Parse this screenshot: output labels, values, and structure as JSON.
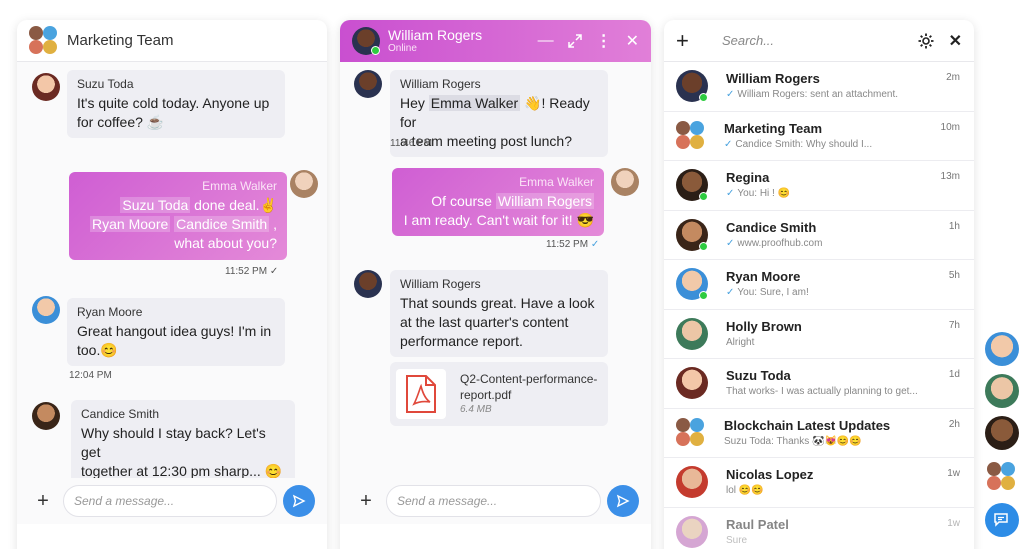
{
  "panel1": {
    "title": "Marketing Team",
    "messages": [
      {
        "name": "Suzu Toda",
        "line1": "It's quite cold today. Anyone up",
        "line2": "for coffee? ☕"
      },
      {
        "name": "Emma Walker",
        "m1": "Suzu Toda",
        "t1": " done deal.✌",
        "m2": "Ryan Moore",
        "m3": "Candice Smith",
        "t2": " ,",
        "t3": "what about you?",
        "time": "11:52 PM"
      },
      {
        "name": "Ryan Moore",
        "line1": "Great hangout idea guys! I'm in",
        "line2": "too.😊",
        "time": "12:04 PM"
      },
      {
        "name": "Candice Smith",
        "line1": "Why should I stay back? Let's get",
        "line2": "together at 12:30 pm sharp... 😊"
      }
    ],
    "placeholder": "Send a message..."
  },
  "panel2": {
    "title": "William Rogers",
    "status": "Online",
    "messages": [
      {
        "name": "William Rogers",
        "pre": "Hey ",
        "mention": "Emma Walker",
        "post": " 👋! Ready for",
        "line2": "a team meeting post lunch?",
        "time": "11:46 PM"
      },
      {
        "name": "Emma Walker",
        "pre": "Of course ",
        "mention": "William Rogers",
        "line2": "I am ready. Can't wait for it! 😎",
        "time": "11:52 PM"
      },
      {
        "name": "William Rogers",
        "line1": "That sounds great. Have a look",
        "line2": "at the last quarter's content",
        "line3": "performance report."
      }
    ],
    "file": {
      "name_line1": "Q2-Content-performance-",
      "name_line2": "report.pdf",
      "size": "6.4 MB"
    },
    "placeholder": "Send a message..."
  },
  "panel3": {
    "search_placeholder": "Search...",
    "items": [
      {
        "name": "William Rogers",
        "sub": "William Rogers: sent an attachment.",
        "time": "2m",
        "check": true
      },
      {
        "name": "Marketing Team",
        "sub": "Candice Smith: Why should I...",
        "time": "10m",
        "check": true
      },
      {
        "name": "Regina",
        "sub": "You: Hi ! 😊",
        "time": "13m",
        "check": true
      },
      {
        "name": "Candice Smith",
        "sub": "www.proofhub.com",
        "time": "1h",
        "check": true
      },
      {
        "name": "Ryan Moore",
        "sub": "You: Sure, I am!",
        "time": "5h",
        "check": true
      },
      {
        "name": "Holly Brown",
        "sub": "Alright",
        "time": "7h",
        "check": false
      },
      {
        "name": "Suzu Toda",
        "sub": "That works- I was actually planning to get...",
        "time": "1d",
        "check": false
      },
      {
        "name": "Blockchain Latest Updates",
        "sub": "Suzu Toda: Thanks 🐼😻😊😊",
        "time": "2h",
        "check": false
      },
      {
        "name": "Nicolas Lopez",
        "sub": "lol 😊😊",
        "time": "1w",
        "check": false
      },
      {
        "name": "Raul Patel",
        "sub": "Sure",
        "time": "1w",
        "check": false
      }
    ]
  },
  "colors": {
    "accent": "#cf5ed3",
    "send": "#3b8fe8",
    "online": "#2ecc40"
  }
}
